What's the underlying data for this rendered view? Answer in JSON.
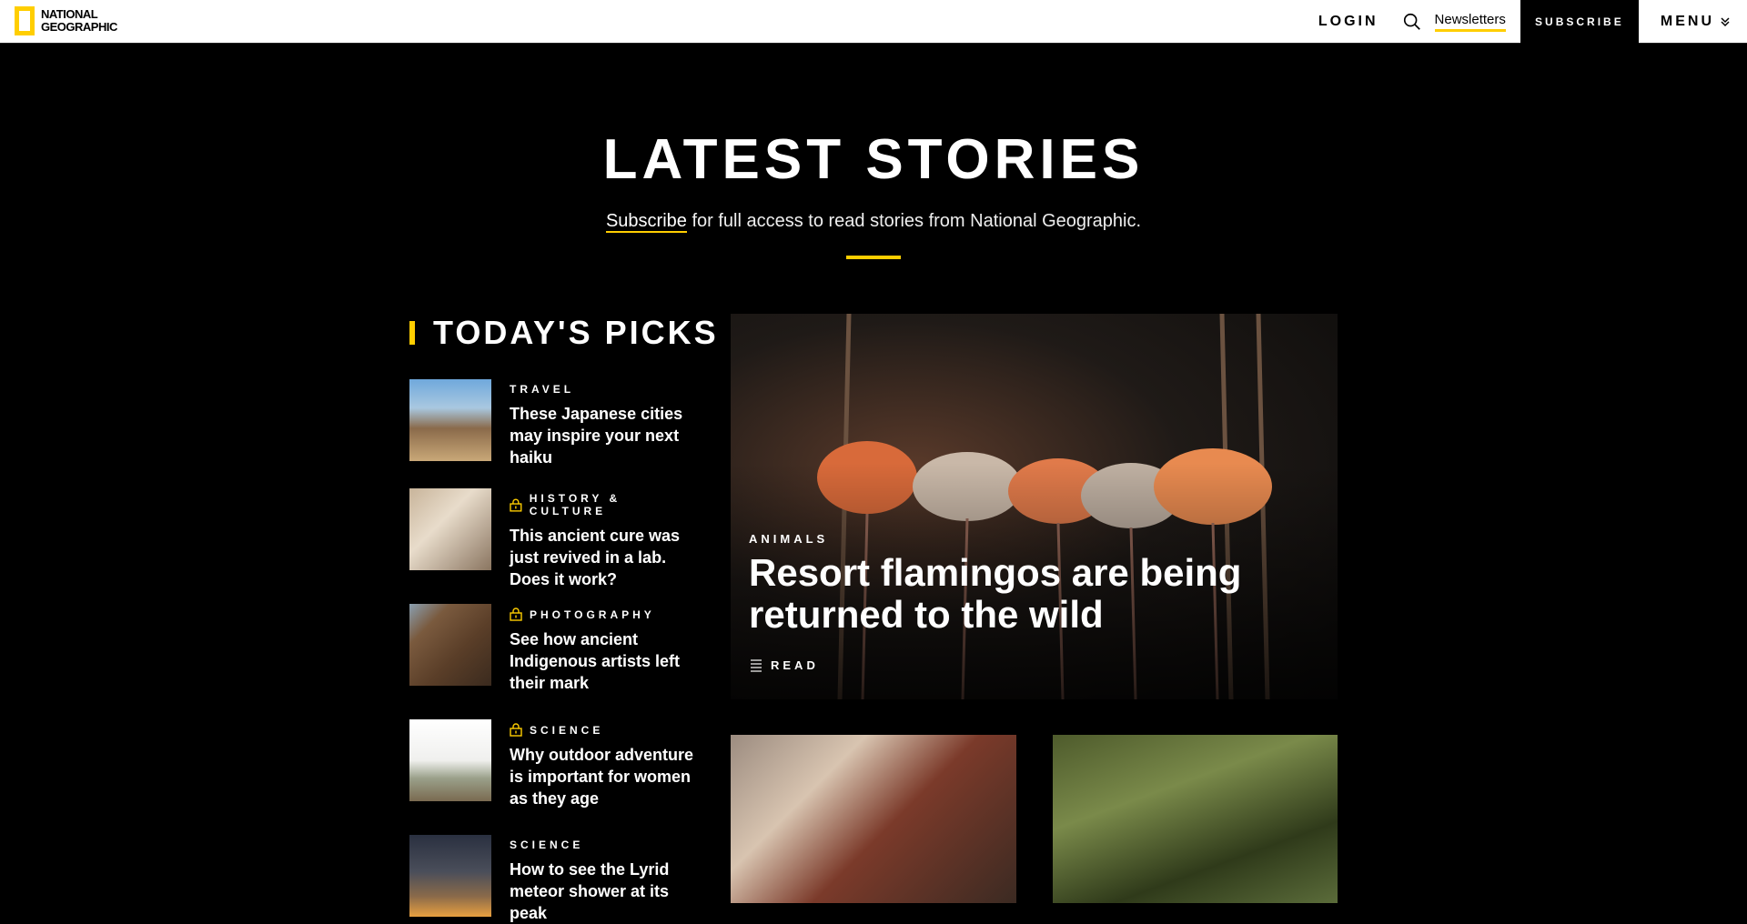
{
  "header": {
    "logo": {
      "line1": "NATIONAL",
      "line2": "GEOGRAPHIC"
    },
    "login": "LOGIN",
    "newsletters": "Newsletters",
    "subscribe": "SUBSCRIBE",
    "menu": "MENU"
  },
  "hero": {
    "title": "LATEST STORIES",
    "subscribe_link": "Subscribe",
    "subtitle_rest": " for full access to read stories from National Geographic."
  },
  "picks": {
    "title": "TODAY'S PICKS",
    "items": [
      {
        "category": "TRAVEL",
        "locked": false,
        "title": "These Japanese cities may inspire your next haiku"
      },
      {
        "category": "HISTORY & CULTURE",
        "locked": true,
        "title": "This ancient cure was just revived in a lab. Does it work?"
      },
      {
        "category": "PHOTOGRAPHY",
        "locked": true,
        "title": "See how ancient Indigenous artists left their mark"
      },
      {
        "category": "SCIENCE",
        "locked": true,
        "title": "Why outdoor adventure is important for women as they age"
      },
      {
        "category": "SCIENCE",
        "locked": false,
        "title": "How to see the Lyrid meteor shower at its peak"
      }
    ]
  },
  "feature": {
    "category": "ANIMALS",
    "title": "Resort flamingos are being returned to the wild",
    "read_label": "READ"
  },
  "colors": {
    "accent": "#ffce00",
    "background": "#000000"
  }
}
